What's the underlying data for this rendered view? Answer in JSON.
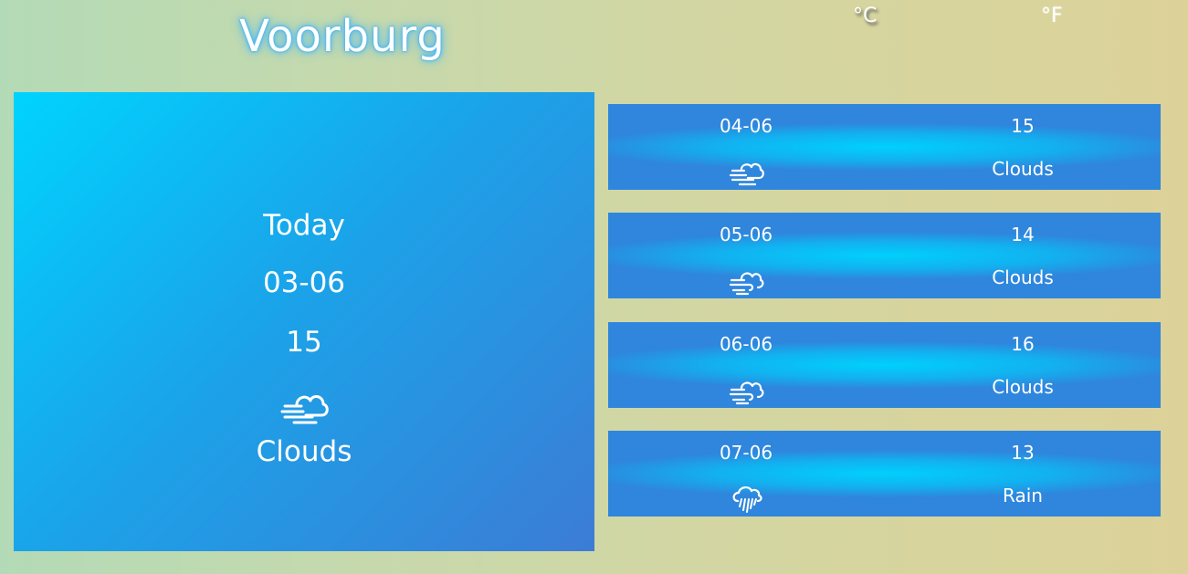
{
  "city": "Voorburg",
  "units": {
    "celsius": "°C",
    "fahrenheit": "°F",
    "selected": "celsius"
  },
  "today": {
    "label": "Today",
    "date": "03-06",
    "temp": "15",
    "icon": "wind-cloud-icon",
    "condition": "Clouds"
  },
  "forecast": [
    {
      "date": "04-06",
      "temp": "15",
      "icon": "wind-cloud-icon",
      "condition": "Clouds"
    },
    {
      "date": "05-06",
      "temp": "14",
      "icon": "wind-cloud-icon",
      "condition": "Clouds"
    },
    {
      "date": "06-06",
      "temp": "16",
      "icon": "wind-cloud-icon",
      "condition": "Clouds"
    },
    {
      "date": "07-06",
      "temp": "13",
      "icon": "rain-cloud-icon",
      "condition": "Rain"
    }
  ],
  "colors": {
    "panel_start": "#00d3fe",
    "panel_end": "#3c7cd6",
    "background_start": "#b3dab6",
    "background_end": "#dcd299"
  }
}
